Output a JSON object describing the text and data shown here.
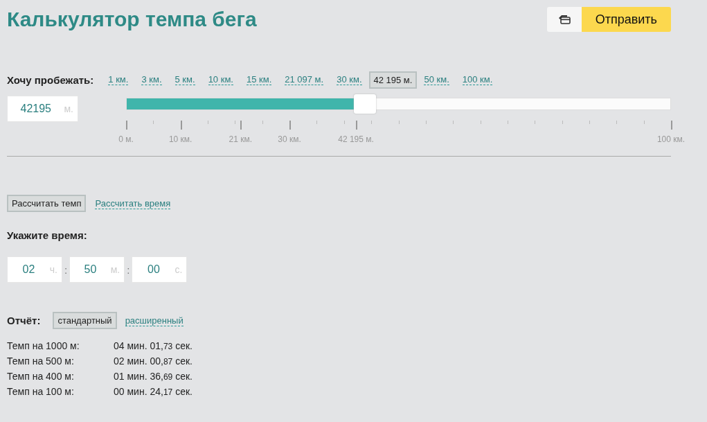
{
  "title": "Калькулятор темпа бега",
  "send_button": {
    "label": "Отправить"
  },
  "distance": {
    "label": "Хочу пробежать:",
    "presets": [
      {
        "label": "1 км.",
        "selected": false
      },
      {
        "label": "3 км.",
        "selected": false
      },
      {
        "label": "5 км.",
        "selected": false
      },
      {
        "label": "10 км.",
        "selected": false
      },
      {
        "label": "15 км.",
        "selected": false
      },
      {
        "label": "21 097 м.",
        "selected": false
      },
      {
        "label": "30 км.",
        "selected": false
      },
      {
        "label": "42 195 м.",
        "selected": true
      },
      {
        "label": "50 км.",
        "selected": false
      },
      {
        "label": "100 км.",
        "selected": false
      }
    ],
    "value": "42195",
    "unit": "м.",
    "slider": {
      "level": 0.42
    },
    "scale": [
      "0 м.",
      "10 км.",
      "21 км.",
      "30 км.",
      "42 195 м.",
      "100 км."
    ]
  },
  "modes": [
    {
      "label": "Рассчитать темп",
      "selected": true
    },
    {
      "label": "Рассчитать время",
      "selected": false
    }
  ],
  "time": {
    "label": "Укажите время:",
    "separator": ":",
    "fields": [
      {
        "value": "02",
        "unit": "ч."
      },
      {
        "value": "50",
        "unit": "м."
      },
      {
        "value": "00",
        "unit": "с."
      }
    ]
  },
  "report": {
    "label": "Отчёт:",
    "types": [
      {
        "label": "стандартный",
        "selected": true
      },
      {
        "label": "расширенный",
        "selected": false
      }
    ],
    "rows": [
      {
        "label": "Темп на 1000 м:",
        "value": "04 мин. 01,",
        "fraction": "73",
        "unit": "сек."
      },
      {
        "label": "Темп на 500 м:",
        "value": "02 мин. 00,",
        "fraction": "87",
        "unit": "сек."
      },
      {
        "label": "Темп на 400 м:",
        "value": "01 мин. 36,",
        "fraction": "69",
        "unit": "сек."
      },
      {
        "label": "Темп на 100 м:",
        "value": "00 мин. 24,",
        "fraction": "17",
        "unit": "сек."
      }
    ]
  }
}
